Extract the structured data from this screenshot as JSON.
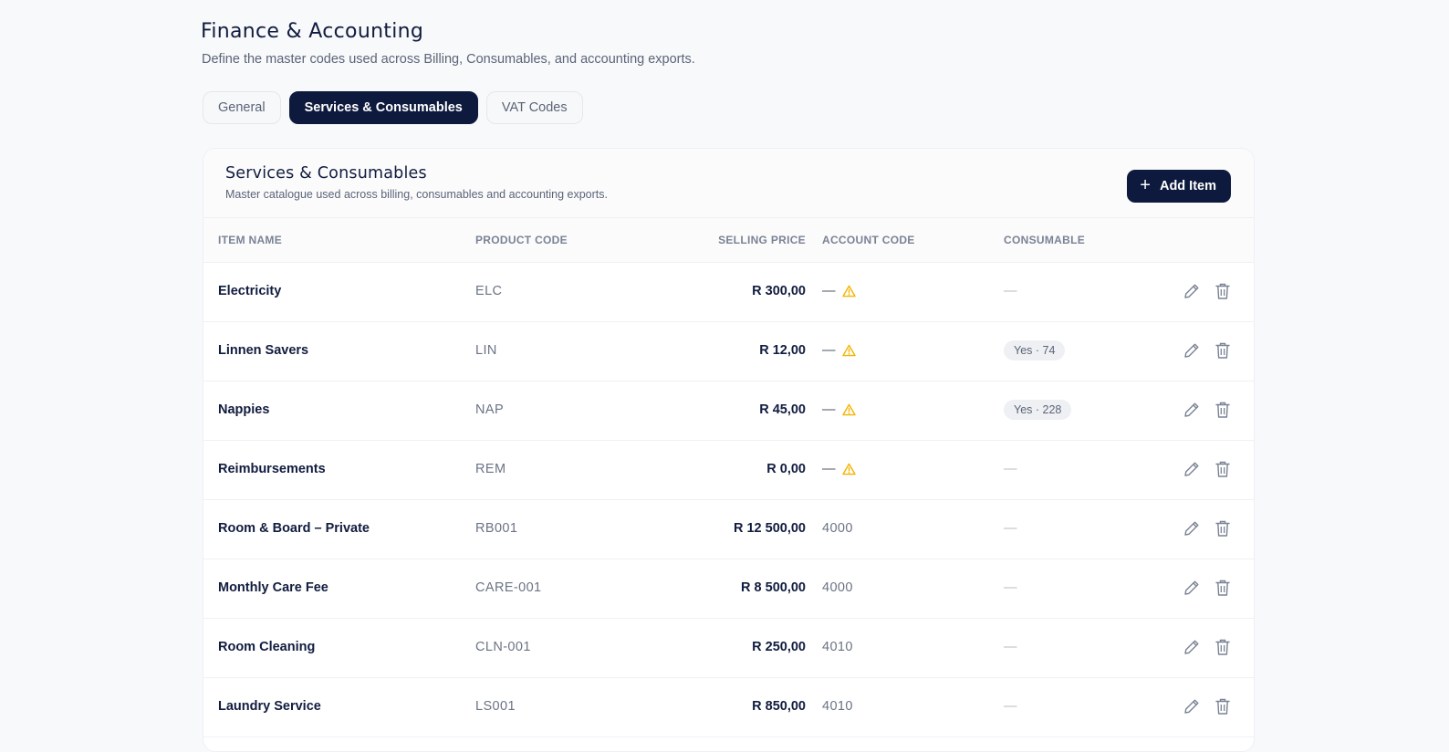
{
  "page": {
    "title": "Finance & Accounting",
    "subtitle": "Define the master codes used across Billing, Consumables, and accounting exports."
  },
  "tabs": [
    {
      "label": "General",
      "active": false
    },
    {
      "label": "Services & Consumables",
      "active": true
    },
    {
      "label": "VAT Codes",
      "active": false
    }
  ],
  "card": {
    "title": "Services & Consumables",
    "subtitle": "Master catalogue used across billing, consumables and accounting exports.",
    "add_label": "Add Item",
    "add_icon": "plus-icon"
  },
  "table": {
    "headers": {
      "name": "ITEM NAME",
      "code": "PRODUCT CODE",
      "price": "SELLING PRICE",
      "account": "ACCOUNT CODE",
      "consumable": "CONSUMABLE"
    },
    "rows": [
      {
        "name": "Electricity",
        "code": "ELC",
        "price": "R 300,00",
        "account": "—",
        "account_warning": true,
        "consumable": "—",
        "consumable_badge": false
      },
      {
        "name": "Linnen Savers",
        "code": "LIN",
        "price": "R 12,00",
        "account": "—",
        "account_warning": true,
        "consumable": "Yes · 74",
        "consumable_badge": true
      },
      {
        "name": "Nappies",
        "code": "NAP",
        "price": "R 45,00",
        "account": "—",
        "account_warning": true,
        "consumable": "Yes · 228",
        "consumable_badge": true
      },
      {
        "name": "Reimbursements",
        "code": "REM",
        "price": "R 0,00",
        "account": "—",
        "account_warning": true,
        "consumable": "—",
        "consumable_badge": false
      },
      {
        "name": "Room & Board – Private",
        "code": "RB001",
        "price": "R 12 500,00",
        "account": "4000",
        "account_warning": false,
        "consumable": "—",
        "consumable_badge": false
      },
      {
        "name": "Monthly Care Fee",
        "code": "CARE-001",
        "price": "R 8 500,00",
        "account": "4000",
        "account_warning": false,
        "consumable": "—",
        "consumable_badge": false
      },
      {
        "name": "Room Cleaning",
        "code": "CLN-001",
        "price": "R 250,00",
        "account": "4010",
        "account_warning": false,
        "consumable": "—",
        "consumable_badge": false
      },
      {
        "name": "Laundry Service",
        "code": "LS001",
        "price": "R 850,00",
        "account": "4010",
        "account_warning": false,
        "consumable": "—",
        "consumable_badge": false
      }
    ]
  },
  "icons": {
    "warning": "warning-icon",
    "edit": "pencil-icon",
    "delete": "trash-icon"
  },
  "colors": {
    "primary": "#0e1a3d",
    "warning": "#f5b300",
    "muted_text": "#6b7385",
    "page_bg": "#f8f9fb"
  }
}
